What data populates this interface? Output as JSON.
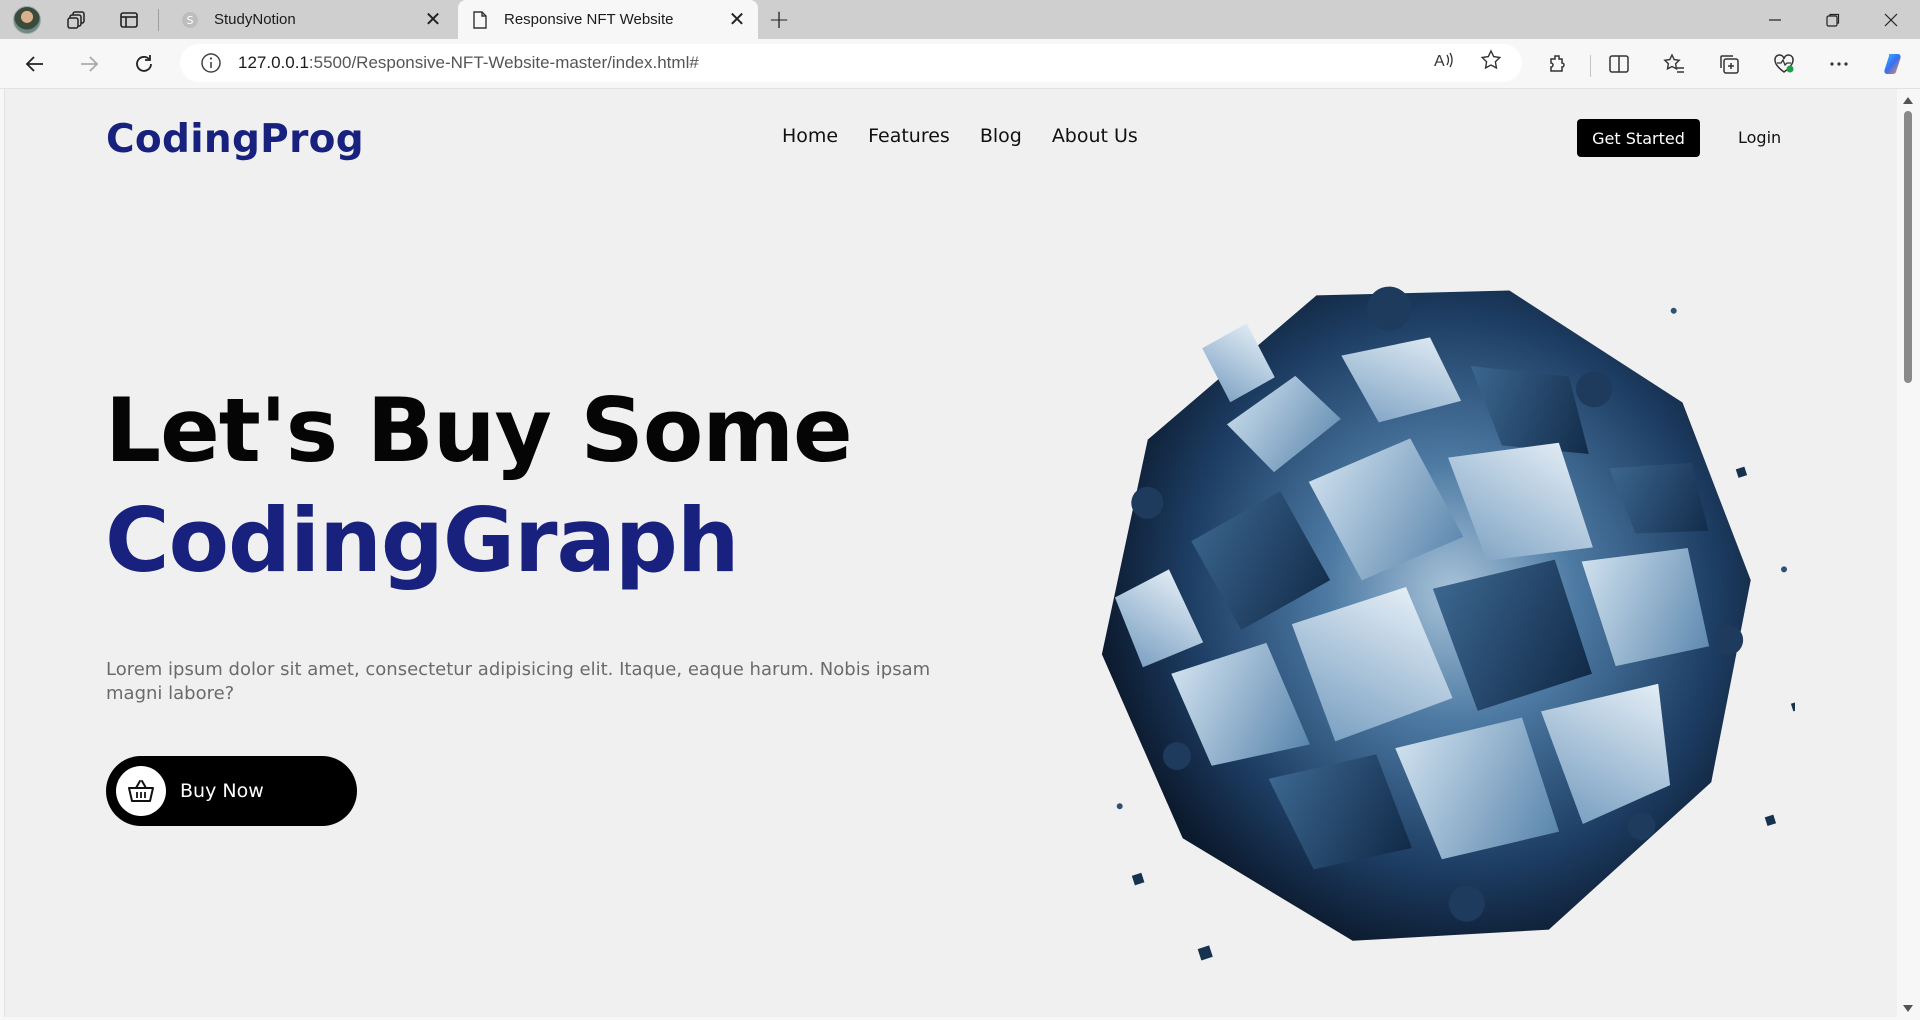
{
  "browser": {
    "tabs": [
      {
        "title": "StudyNotion",
        "active": false,
        "icon": "studynotion-favicon"
      },
      {
        "title": "Responsive NFT Website",
        "active": true,
        "icon": "page-icon"
      }
    ],
    "url_host": "127.0.0.1",
    "url_path": ":5500/Responsive-NFT-Website-master/index.html#"
  },
  "site": {
    "logo": "CodingProg",
    "nav": [
      {
        "label": "Home"
      },
      {
        "label": "Features"
      },
      {
        "label": "Blog"
      },
      {
        "label": "About Us"
      }
    ],
    "cta_label": "Get Started",
    "login_label": "Login"
  },
  "hero": {
    "heading_line1": "Let's Buy Some",
    "heading_line2": "CodingGraph",
    "description": "Lorem ipsum dolor sit amet, consectetur adipisicing elit. Itaque, eaque harum. Nobis ipsam magni labore?",
    "buy_label": "Buy Now",
    "buy_icon": "basket-icon",
    "art": "abstract-blue-cube-sphere"
  },
  "colors": {
    "brand": "#18227e",
    "button": "#000000",
    "page_bg": "#f0f0f0"
  }
}
